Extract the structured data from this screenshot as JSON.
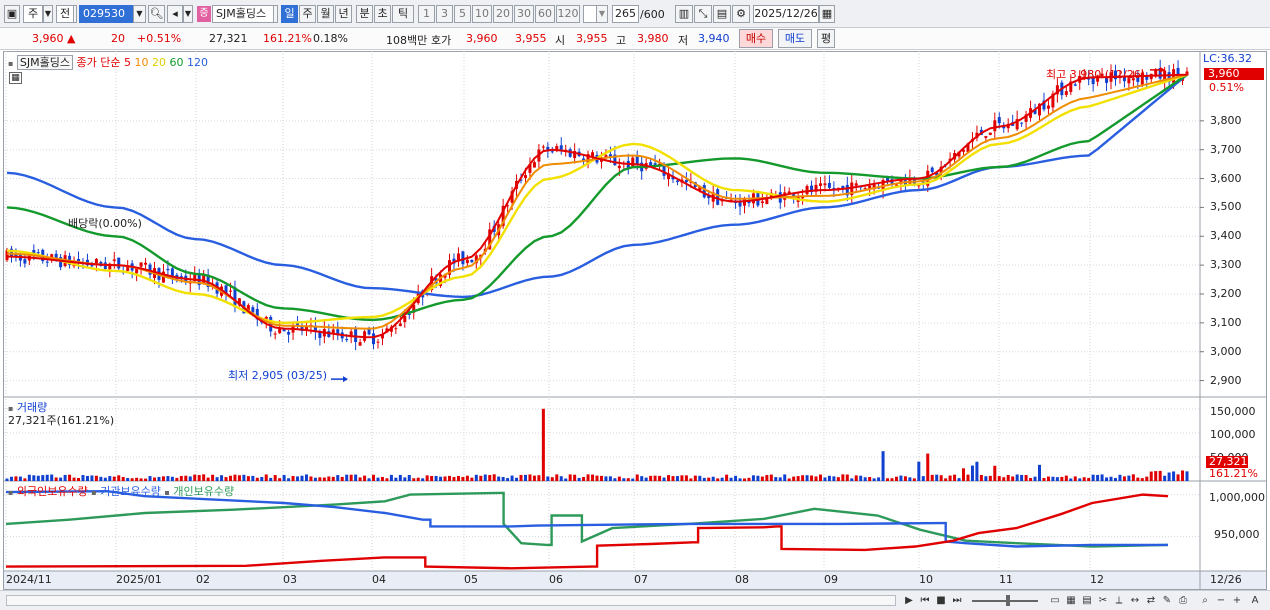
{
  "toolbar": {
    "period_label": "주",
    "prev_label": "전",
    "code": "029530",
    "badge": "증",
    "stock_name": "SJM홀딩스",
    "periods": [
      "일",
      "주",
      "월",
      "년",
      "분",
      "초",
      "틱"
    ],
    "intervals": [
      "1",
      "3",
      "5",
      "10",
      "20",
      "30",
      "60",
      "120"
    ],
    "count": "265",
    "count_total": "/600",
    "date": "2025/12/26"
  },
  "quote": {
    "price": "3,960",
    "arrow": "▲",
    "change": "20",
    "change_pct": "+0.51%",
    "volume": "27,321",
    "volume_ratio": "161.21%",
    "turnover": "0.18%",
    "amount": "108백만",
    "bid_label": "호가",
    "bid": "3,960",
    "ask": "3,955",
    "open_label": "시",
    "open": "3,955",
    "high_label": "고",
    "high": "3,980",
    "low_label": "저",
    "low": "3,940",
    "buy_label": "매수",
    "sell_label": "매도",
    "eval_label": "평"
  },
  "price_pane": {
    "name_chip": "SJM홀딩스",
    "ma_title": "종가 단순",
    "ma_periods": [
      "5",
      "10",
      "20",
      "60",
      "120"
    ],
    "lc_label": "LC:36.32",
    "current_price": "3,960",
    "change_pct_axis": "0.51%",
    "high_note": "최고 3,980 (12/26)",
    "low_note": "최저 2,905 (03/25)",
    "dividend_note": "배당락(0.00%)",
    "y_ticks": [
      "3,800",
      "3,700",
      "3,600",
      "3,500",
      "3,400",
      "3,300",
      "3,200",
      "3,100",
      "3,000",
      "2,900"
    ]
  },
  "volume_pane": {
    "title": "거래량",
    "value_text": "27,321주(161.21%)",
    "y_ticks": [
      "150,000",
      "100,000",
      "50,000"
    ],
    "current": "27,321",
    "ratio": "161.21%"
  },
  "holding_pane": {
    "series_labels": [
      "외국인보유수량",
      "기관보유수량",
      "개인보유수량"
    ],
    "y_ticks": [
      "1,000,000",
      "950,000"
    ]
  },
  "x_axis": {
    "labels": [
      "2024/11",
      "2025/01",
      "02",
      "03",
      "04",
      "05",
      "06",
      "07",
      "08",
      "09",
      "10",
      "11",
      "12"
    ],
    "end_label": "12/26"
  },
  "colors": {
    "up": "#e00000",
    "down": "#1040d0",
    "ma5": "#e00000",
    "ma10": "#f08c00",
    "ma20": "#f2e000",
    "ma60": "#149a2c",
    "ma120": "#2a5ee0",
    "foreign": "#e00000",
    "institution": "#2a5ee0",
    "individual": "#2e9a5a"
  },
  "chart_data": {
    "type": "line",
    "x": [
      "2024/11",
      "2025/01",
      "02",
      "03",
      "04",
      "05",
      "06",
      "07",
      "08",
      "09",
      "10",
      "11",
      "12"
    ],
    "series": [
      {
        "name": "5",
        "values": [
          3330,
          3300,
          3250,
          3080,
          3050,
          3320,
          3700,
          3650,
          3520,
          3560,
          3600,
          3780,
          3950
        ]
      },
      {
        "name": "10",
        "values": [
          3340,
          3300,
          3240,
          3090,
          3080,
          3290,
          3650,
          3680,
          3530,
          3540,
          3590,
          3740,
          3880
        ]
      },
      {
        "name": "20",
        "values": [
          3350,
          3280,
          3200,
          3100,
          3120,
          3260,
          3600,
          3720,
          3560,
          3520,
          3580,
          3720,
          3850
        ]
      },
      {
        "name": "60",
        "values": [
          3500,
          3400,
          3270,
          3150,
          3110,
          3180,
          3400,
          3640,
          3670,
          3620,
          3600,
          3640,
          3730
        ]
      },
      {
        "name": "120",
        "values": [
          3620,
          3500,
          3390,
          3300,
          3220,
          3190,
          3260,
          3370,
          3440,
          3500,
          3560,
          3640,
          3680
        ]
      }
    ],
    "high": {
      "value": 3980,
      "date": "12/26"
    },
    "low": {
      "value": 2905,
      "date": "03/25"
    },
    "ylim": [
      2850,
      3990
    ],
    "volume_ylim": [
      0,
      160000
    ],
    "holding_ylim": [
      910000,
      1015000
    ]
  }
}
